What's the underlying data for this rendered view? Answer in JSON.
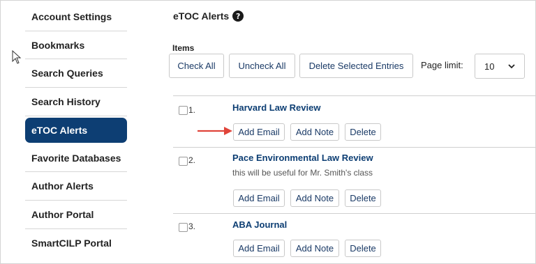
{
  "sidebar": {
    "items": [
      {
        "label": "Account Settings"
      },
      {
        "label": "Bookmarks"
      },
      {
        "label": "Search Queries"
      },
      {
        "label": "Search History"
      },
      {
        "label": "eTOC Alerts",
        "active": true
      },
      {
        "label": "Favorite Databases"
      },
      {
        "label": "Author Alerts"
      },
      {
        "label": "Author Portal"
      },
      {
        "label": "SmartCILP Portal"
      }
    ]
  },
  "main": {
    "title": "eTOC Alerts",
    "help_icon": "question-circle-icon",
    "items_label": "Items",
    "toolbar": {
      "check_all": "Check All",
      "uncheck_all": "Uncheck All",
      "delete_selected": "Delete Selected Entries",
      "page_limit_label": "Page limit:",
      "page_limit_value": "10"
    },
    "entries": [
      {
        "number": "1.",
        "title": "Harvard Law Review",
        "note": ""
      },
      {
        "number": "2.",
        "title": "Pace Environmental Law Review",
        "note": "this will be useful for Mr. Smith's class"
      },
      {
        "number": "3.",
        "title": "ABA Journal",
        "note": ""
      }
    ],
    "actions": {
      "add_email": "Add Email",
      "add_note": "Add Note",
      "delete": "Delete"
    }
  },
  "colors": {
    "active_bg": "#0d3e73",
    "link": "#0d3e73",
    "annotation_arrow": "#e0443a"
  }
}
